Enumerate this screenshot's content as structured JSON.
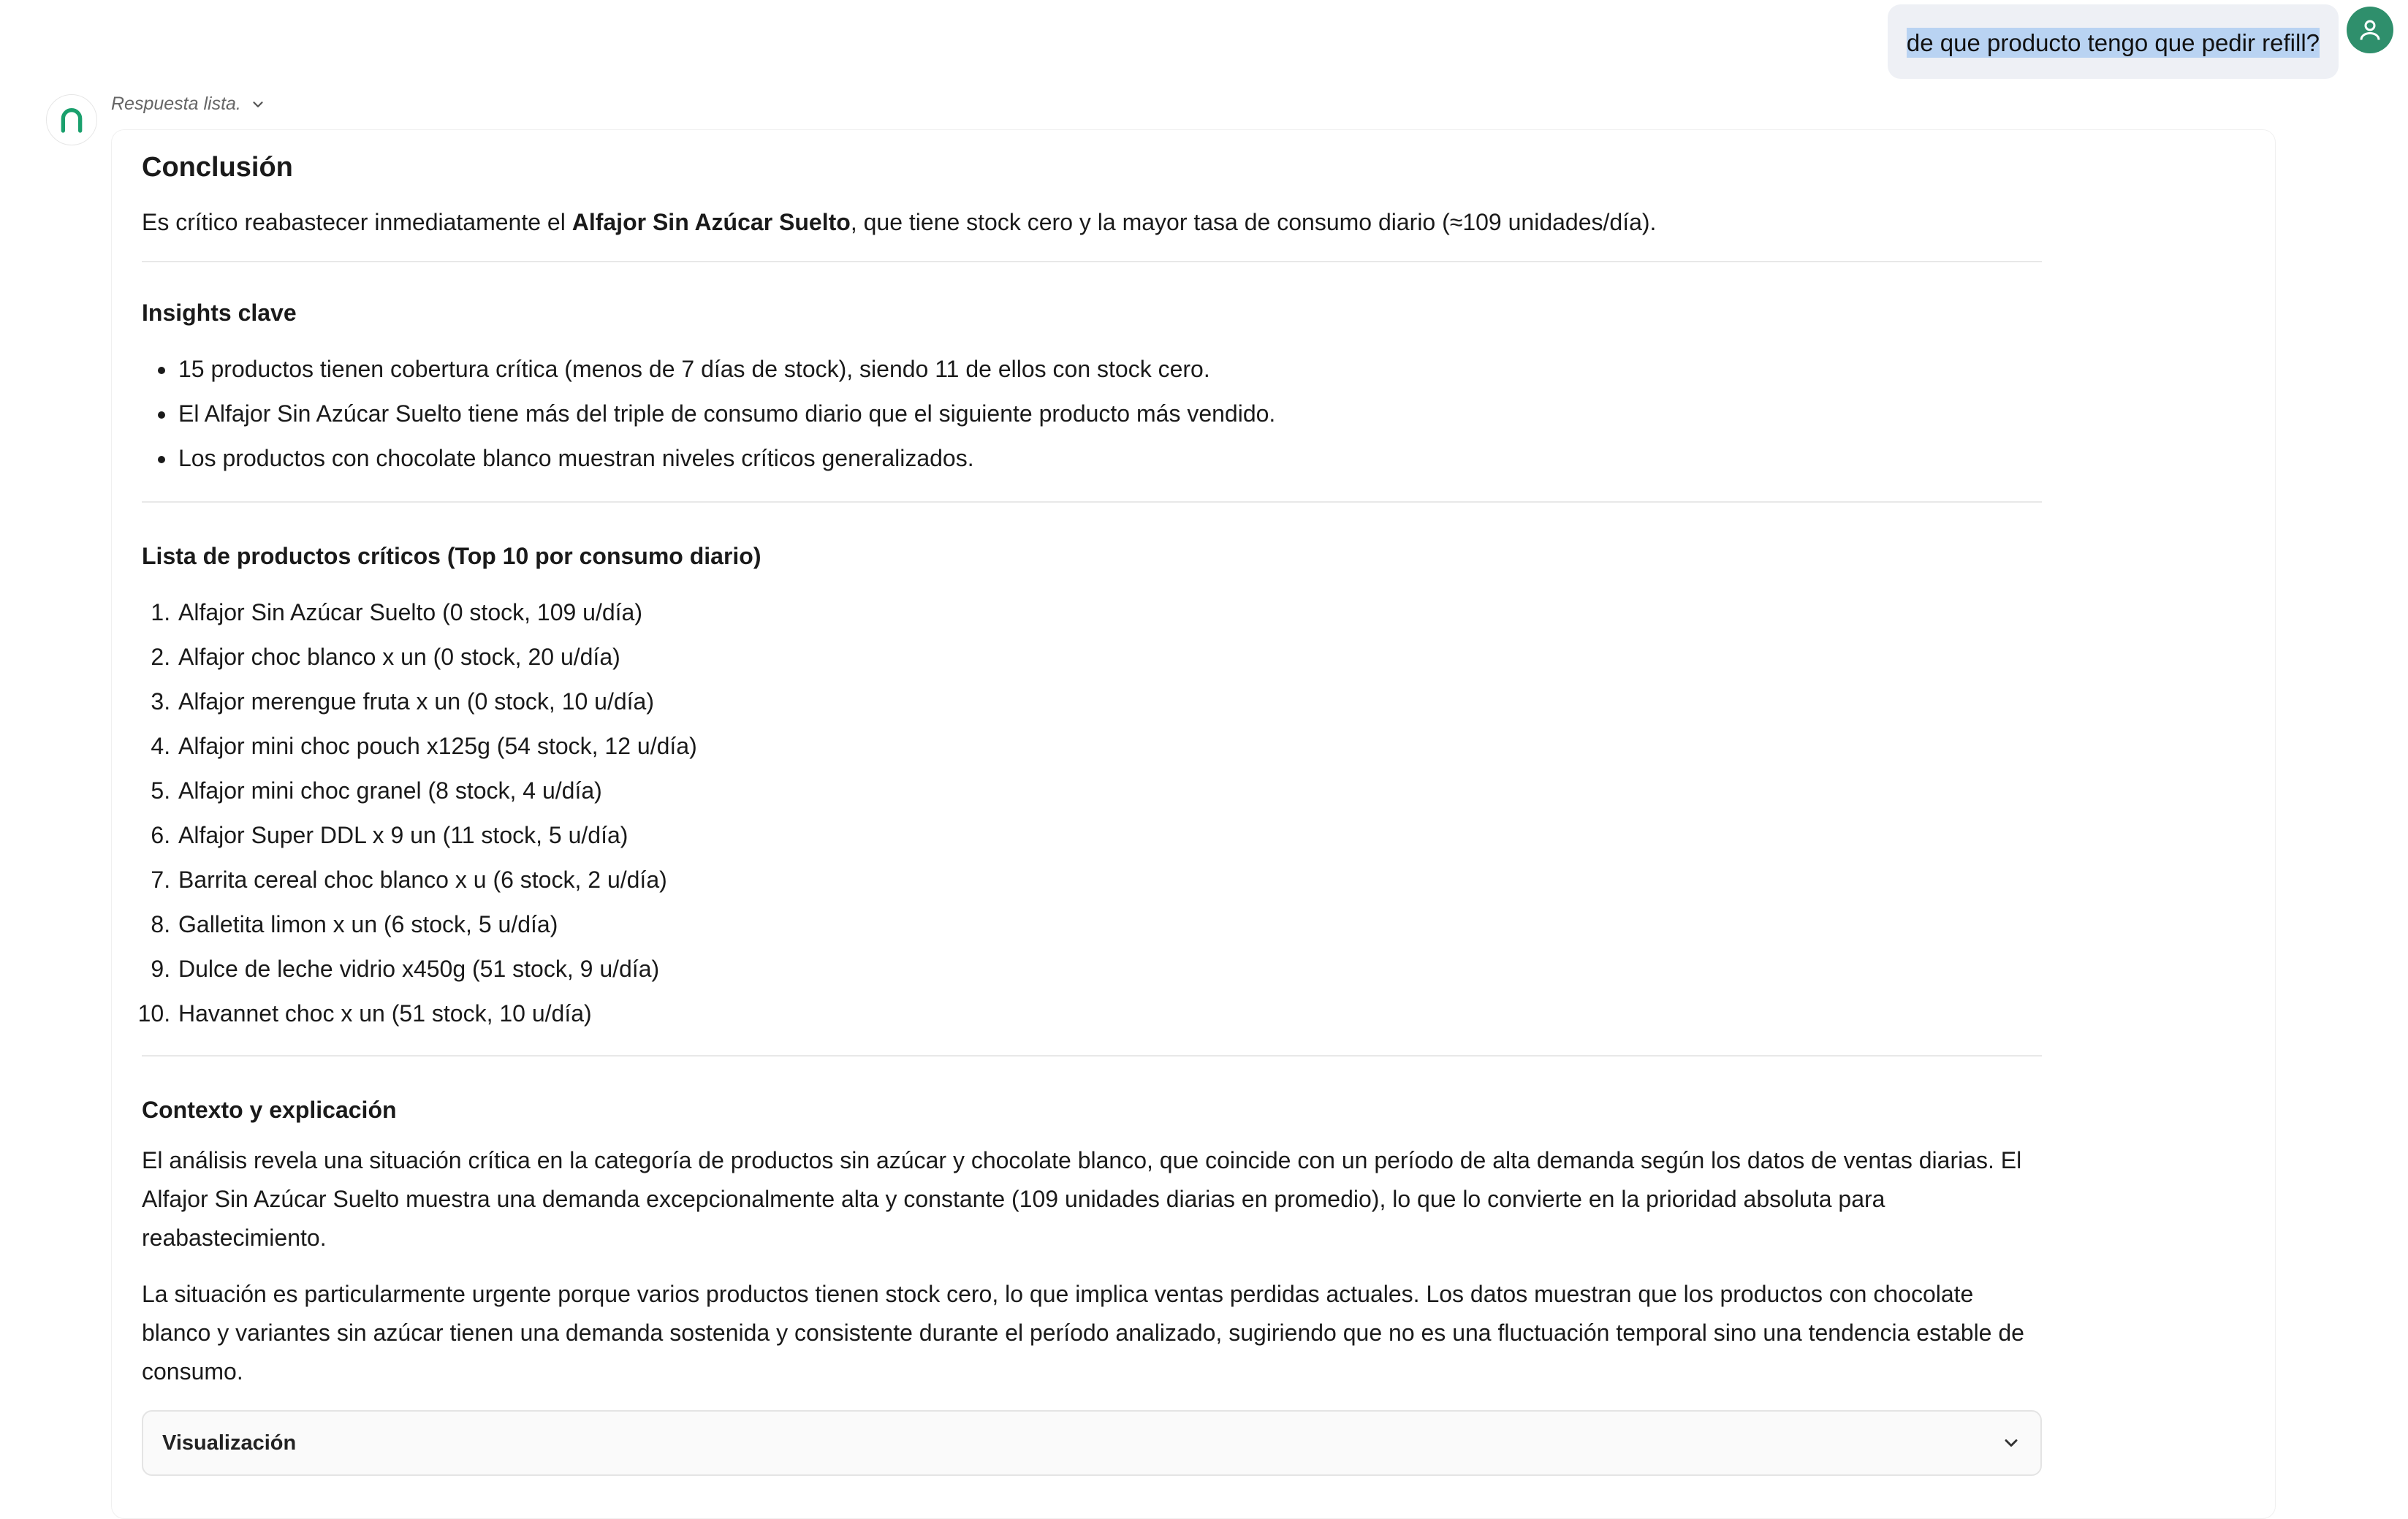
{
  "user_message": {
    "text": "de que producto tengo que pedir refill?"
  },
  "assistant": {
    "status": "Respuesta lista.",
    "conclusion": {
      "title": "Conclusión",
      "text_before": "Es crítico reabastecer inmediatamente el ",
      "text_bold": "Alfajor Sin Azúcar Suelto",
      "text_after": ", que tiene stock cero y la mayor tasa de consumo diario (≈109 unidades/día)."
    },
    "insights": {
      "title": "Insights clave",
      "items": [
        "15 productos tienen cobertura crítica (menos de 7 días de stock), siendo 11 de ellos con stock cero.",
        "El Alfajor Sin Azúcar Suelto tiene más del triple de consumo diario que el siguiente producto más vendido.",
        "Los productos con chocolate blanco muestran niveles críticos generalizados."
      ]
    },
    "critical_list": {
      "title": "Lista de productos críticos (Top 10 por consumo diario)",
      "items": [
        "Alfajor Sin Azúcar Suelto (0 stock, 109 u/día)",
        "Alfajor choc blanco x un (0 stock, 20 u/día)",
        "Alfajor merengue fruta x un (0 stock, 10 u/día)",
        "Alfajor mini choc pouch x125g (54 stock, 12 u/día)",
        "Alfajor mini choc granel (8 stock, 4 u/día)",
        "Alfajor Super DDL x 9 un (11 stock, 5 u/día)",
        "Barrita cereal choc blanco x u (6 stock, 2 u/día)",
        "Galletita limon x un (6 stock, 5 u/día)",
        "Dulce de leche vidrio x450g (51 stock, 9 u/día)",
        "Havannet choc x un (51 stock, 10 u/día)"
      ]
    },
    "context": {
      "title": "Contexto y explicación",
      "paragraph1": "El análisis revela una situación crítica en la categoría de productos sin azúcar y chocolate blanco, que coincide con un período de alta demanda según los datos de ventas diarias. El Alfajor Sin Azúcar Suelto muestra una demanda excepcionalmente alta y constante (109 unidades diarias en promedio), lo que lo convierte en la prioridad absoluta para reabastecimiento.",
      "paragraph2": "La situación es particularmente urgente porque varios productos tienen stock cero, lo que implica ventas perdidas actuales. Los datos muestran que los productos con chocolate blanco y variantes sin azúcar tienen una demanda sostenida y consistente durante el período analizado, sugiriendo que no es una fluctuación temporal sino una tendencia estable de consumo."
    },
    "visualization": {
      "label": "Visualización"
    }
  },
  "colors": {
    "user_avatar": "#2f8f6c",
    "bot_logo": "#1aa06d",
    "selection": "#b9d3f2",
    "bubble": "#eef0f5"
  },
  "icons": {
    "user_avatar": "user-icon",
    "bot_avatar": "arch-logo-icon",
    "status_toggle": "chevron-down-icon",
    "viz_toggle": "chevron-down-icon"
  }
}
